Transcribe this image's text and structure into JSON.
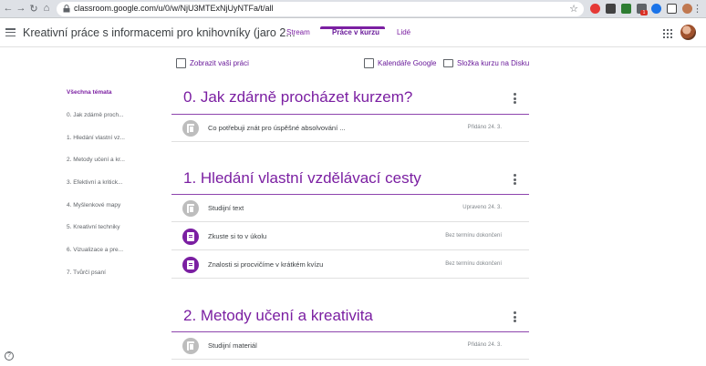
{
  "browser": {
    "url": "classroom.google.com/u/0/w/NjU3MTExNjUyNTFa/t/all",
    "extension_badge": "1"
  },
  "header": {
    "course_title": "Kreativní práce s informacemi pro knihovníky (jaro 2...",
    "tabs": [
      {
        "label": "Stream"
      },
      {
        "label": "Práce v kurzu"
      },
      {
        "label": "Lidé"
      }
    ]
  },
  "actions": {
    "view_work": "Zobrazit vaši práci",
    "calendar": "Kalendáře Google",
    "drive_folder": "Složka kurzu na Disku"
  },
  "topics": [
    "Všechna témata",
    "0. Jak zdárně proch...",
    "1. Hledání vlastní vz...",
    "2. Metody učení a kr...",
    "3. Efektivní a kritick...",
    "4. Myšlenkové mapy",
    "5. Kreativní techniky",
    "6. Vizualizace a pre...",
    "7. Tvůrčí psaní"
  ],
  "sections": [
    {
      "title": "0. Jak zdárně procházet kurzem?",
      "items": [
        {
          "name": "Co potřebuji znát pro úspěšné absolvování ...",
          "meta": "Přidáno 24. 3.",
          "icon": "material-icon"
        }
      ]
    },
    {
      "title": "1. Hledání vlastní vzdělávací cesty",
      "items": [
        {
          "name": "Studijní text",
          "meta": "Upraveno 24. 3.",
          "icon": "material-icon"
        },
        {
          "name": "Zkuste si to v úkolu",
          "meta": "Bez termínu dokončení",
          "icon": "assignment-icon"
        },
        {
          "name": "Znalosti si procvičíme v krátkém kvízu",
          "meta": "Bez termínu dokončení",
          "icon": "assignment-icon"
        }
      ]
    },
    {
      "title": "2. Metody učení a kreativita",
      "items": [
        {
          "name": "Studijní materiál",
          "meta": "Přidáno 24. 3.",
          "icon": "material-icon"
        }
      ]
    }
  ],
  "colors": {
    "accent": "#7b1fa2",
    "text": "#3c4043",
    "muted": "#80868b"
  }
}
